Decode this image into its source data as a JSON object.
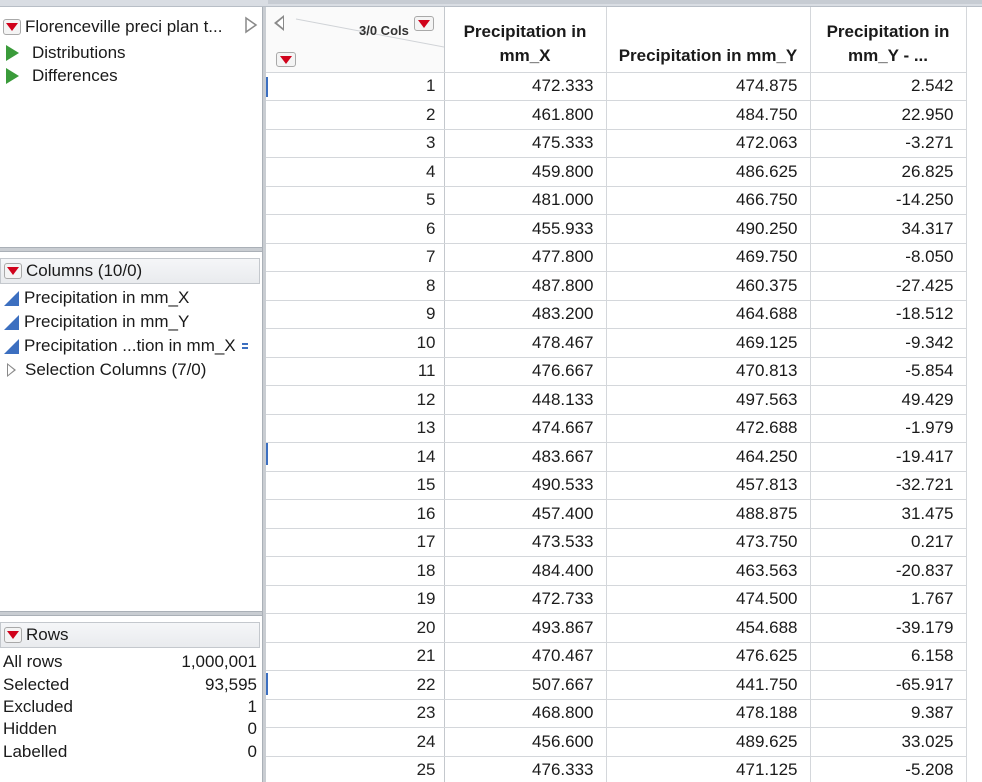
{
  "table_panel": {
    "title": "Florenceville preci plan t...",
    "scripts": [
      "Distributions",
      "Differences"
    ]
  },
  "columns_panel": {
    "title": "Columns (10/0)",
    "items": [
      "Precipitation in mm_X",
      "Precipitation in mm_Y",
      "Precipitation ...tion in mm_X"
    ],
    "group": "Selection Columns (7/0)"
  },
  "rows_panel": {
    "title": "Rows",
    "stats": [
      {
        "label": "All rows",
        "value": "1,000,001"
      },
      {
        "label": "Selected",
        "value": "93,595"
      },
      {
        "label": "Excluded",
        "value": "1"
      },
      {
        "label": "Hidden",
        "value": "0"
      },
      {
        "label": "Labelled",
        "value": "0"
      }
    ]
  },
  "grid": {
    "cols_indicator": "3/0 Cols",
    "headers": {
      "x": [
        "Precipitation in",
        "mm_X"
      ],
      "y": [
        "",
        "Precipitation in mm_Y"
      ],
      "d": [
        "Precipitation in",
        "mm_Y - ..."
      ]
    },
    "rows": [
      [
        "1",
        "472.333",
        "474.875",
        "2.542"
      ],
      [
        "2",
        "461.800",
        "484.750",
        "22.950"
      ],
      [
        "3",
        "475.333",
        "472.063",
        "-3.271"
      ],
      [
        "4",
        "459.800",
        "486.625",
        "26.825"
      ],
      [
        "5",
        "481.000",
        "466.750",
        "-14.250"
      ],
      [
        "6",
        "455.933",
        "490.250",
        "34.317"
      ],
      [
        "7",
        "477.800",
        "469.750",
        "-8.050"
      ],
      [
        "8",
        "487.800",
        "460.375",
        "-27.425"
      ],
      [
        "9",
        "483.200",
        "464.688",
        "-18.512"
      ],
      [
        "10",
        "478.467",
        "469.125",
        "-9.342"
      ],
      [
        "11",
        "476.667",
        "470.813",
        "-5.854"
      ],
      [
        "12",
        "448.133",
        "497.563",
        "49.429"
      ],
      [
        "13",
        "474.667",
        "472.688",
        "-1.979"
      ],
      [
        "14",
        "483.667",
        "464.250",
        "-19.417"
      ],
      [
        "15",
        "490.533",
        "457.813",
        "-32.721"
      ],
      [
        "16",
        "457.400",
        "488.875",
        "31.475"
      ],
      [
        "17",
        "473.533",
        "473.750",
        "0.217"
      ],
      [
        "18",
        "484.400",
        "463.563",
        "-20.837"
      ],
      [
        "19",
        "472.733",
        "474.500",
        "1.767"
      ],
      [
        "20",
        "493.867",
        "454.688",
        "-39.179"
      ],
      [
        "21",
        "470.467",
        "476.625",
        "6.158"
      ],
      [
        "22",
        "507.667",
        "441.750",
        "-65.917"
      ],
      [
        "23",
        "468.800",
        "478.188",
        "9.387"
      ],
      [
        "24",
        "456.600",
        "489.625",
        "33.025"
      ],
      [
        "25",
        "476.333",
        "471.125",
        "-5.208"
      ]
    ]
  },
  "colors": {
    "red_triangle": "#d0021b",
    "green_triangle": "#3a9b3a",
    "continuous_icon": "#3c6fc0"
  }
}
